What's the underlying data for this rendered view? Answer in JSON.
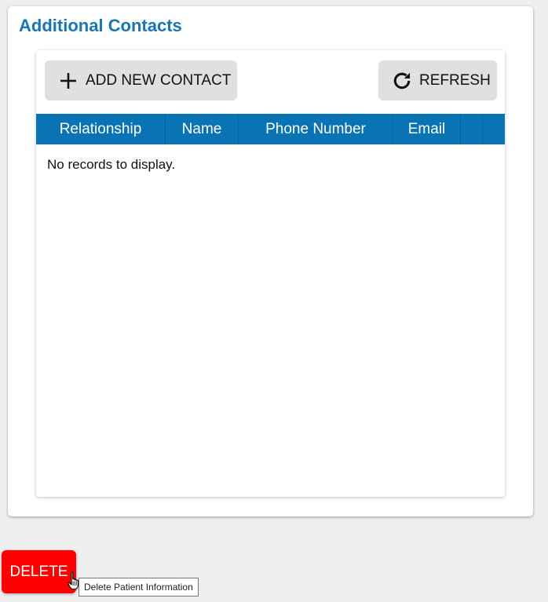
{
  "panel": {
    "title": "Additional Contacts"
  },
  "toolbar": {
    "add_label": "ADD NEW CONTACT",
    "add_icon": "plus-icon",
    "refresh_label": "REFRESH",
    "refresh_icon": "refresh-icon"
  },
  "grid": {
    "columns": [
      "Relationship",
      "Name",
      "Phone Number",
      "Email",
      "",
      ""
    ],
    "empty_message": "No records to display.",
    "header_color": "#0a73b4"
  },
  "actions": {
    "delete_label": "DELETE",
    "delete_color": "#ff0000",
    "delete_tooltip": "Delete Patient Information"
  }
}
